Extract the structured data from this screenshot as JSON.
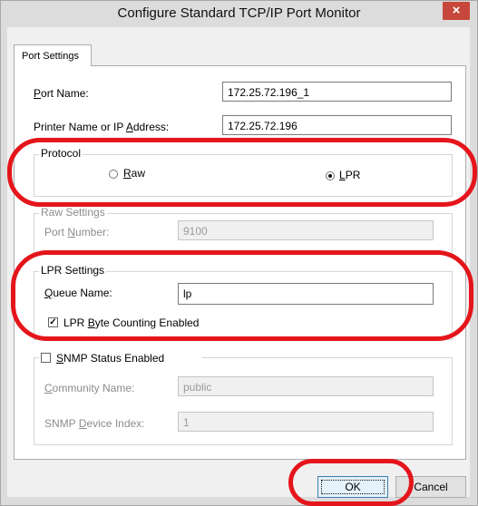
{
  "window": {
    "title": "Configure Standard TCP/IP Port Monitor",
    "close_glyph": "×"
  },
  "tabs": [
    {
      "label": "Port Settings"
    }
  ],
  "fields": {
    "port_name": {
      "label": "Port Name:",
      "value": "172.25.72.196_1"
    },
    "printer_name": {
      "label": "Printer Name or IP Address:",
      "value": "172.25.72.196"
    }
  },
  "protocol": {
    "title": "Protocol",
    "options": [
      {
        "label": "Raw",
        "selected": false
      },
      {
        "label": "LPR",
        "selected": true
      }
    ]
  },
  "raw_settings": {
    "title": "Raw Settings",
    "port_number_label": "Port Number:",
    "port_number_value": "9100"
  },
  "lpr_settings": {
    "title": "LPR Settings",
    "queue_name_label": "Queue Name:",
    "queue_name_value": "lp",
    "byte_counting_label": "LPR Byte Counting Enabled",
    "byte_counting_checked": true
  },
  "snmp": {
    "label": "SNMP Status Enabled",
    "checked": false,
    "community_name_label": "Community Name:",
    "community_name_value": "public",
    "device_index_label": "SNMP Device Index:",
    "device_index_value": "1"
  },
  "buttons": {
    "ok": "OK",
    "cancel": "Cancel"
  },
  "colors": {
    "annotation": "#e4151b",
    "close_button": "#c7473c",
    "title_bar": "#dcdcdc"
  }
}
